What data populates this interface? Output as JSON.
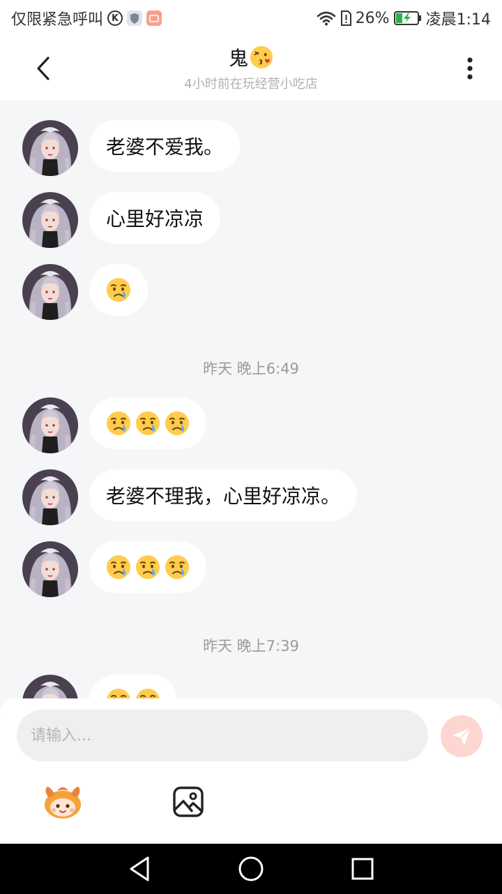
{
  "status_bar": {
    "carrier": "仅限紧急呼叫",
    "battery_percent": "26%",
    "time": "凌晨1:14",
    "icons": [
      "k-circle-icon",
      "shield-app-icon",
      "orange-app-icon",
      "wifi-icon",
      "sim-alert-icon",
      "battery-charging-icon"
    ]
  },
  "header": {
    "title": "鬼",
    "title_emoji": "kissing-face-emoji",
    "subtitle": "4小时前在玩经营小吃店"
  },
  "messages": [
    {
      "text": "老婆不爱我。",
      "emojis": 0
    },
    {
      "text": "心里好凉凉",
      "emojis": 0
    },
    {
      "text": "",
      "emojis": 1,
      "emoji_name": "crying-face-emoji"
    },
    {
      "text": "",
      "emojis": 3,
      "emoji_name": "crying-face-emoji"
    },
    {
      "text": "老婆不理我，心里好凉凉。",
      "emojis": 0
    },
    {
      "text": "",
      "emojis": 3,
      "emoji_name": "crying-face-emoji"
    },
    {
      "text": "",
      "emojis": 2,
      "emoji_name": "crying-face-emoji"
    }
  ],
  "time_separators": [
    "昨天 晚上6:49",
    "昨天 晚上7:39"
  ],
  "input": {
    "placeholder": "请输入..."
  },
  "toolbar": {
    "icons": [
      "sticker-mascot-icon",
      "image-icon",
      "send-icon"
    ]
  },
  "colors": {
    "chat_background": "#f5f6f8",
    "send_button": "#fcd6cf",
    "bubble": "#ffffff"
  }
}
